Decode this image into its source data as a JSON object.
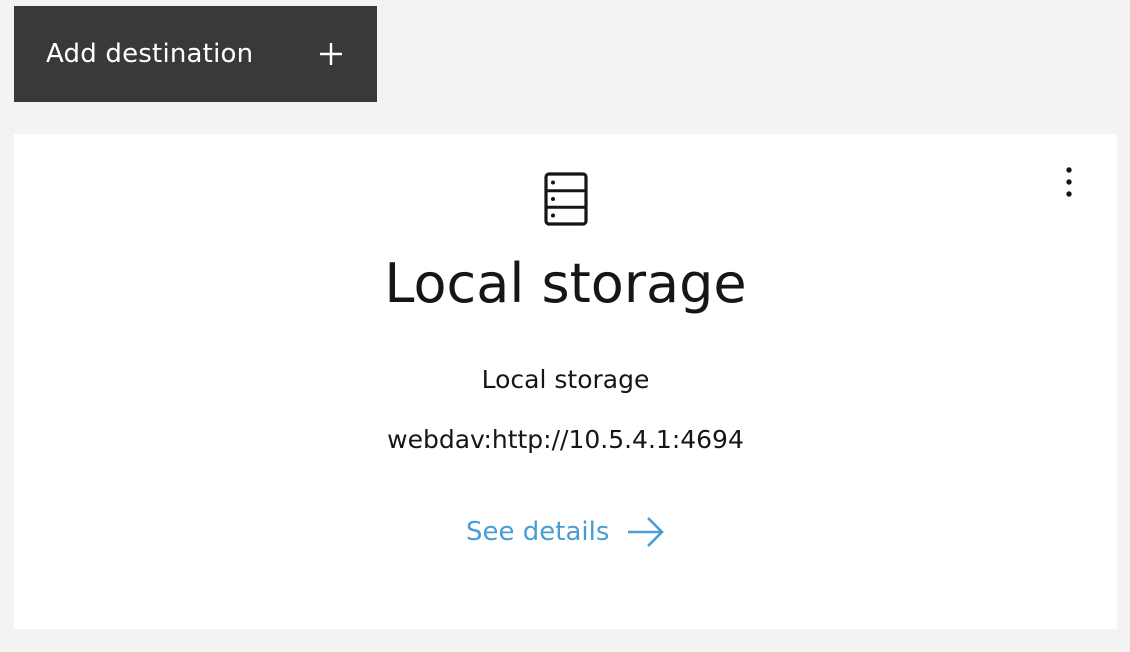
{
  "toolbar": {
    "add_destination_label": "Add destination",
    "add_icon": "plus-icon"
  },
  "card": {
    "icon": "server-rack-icon",
    "title": "Local storage",
    "type_label": "Local storage",
    "address": "webdav:http://10.5.4.1:4694",
    "details_link_label": "See details",
    "details_icon": "arrow-right-icon",
    "menu_icon": "overflow-menu-vertical-icon"
  },
  "colors": {
    "page_background": "#f3f3f3",
    "button_background": "#393939",
    "card_background": "#ffffff",
    "text_primary": "#161616",
    "link": "#4a9cd6"
  }
}
